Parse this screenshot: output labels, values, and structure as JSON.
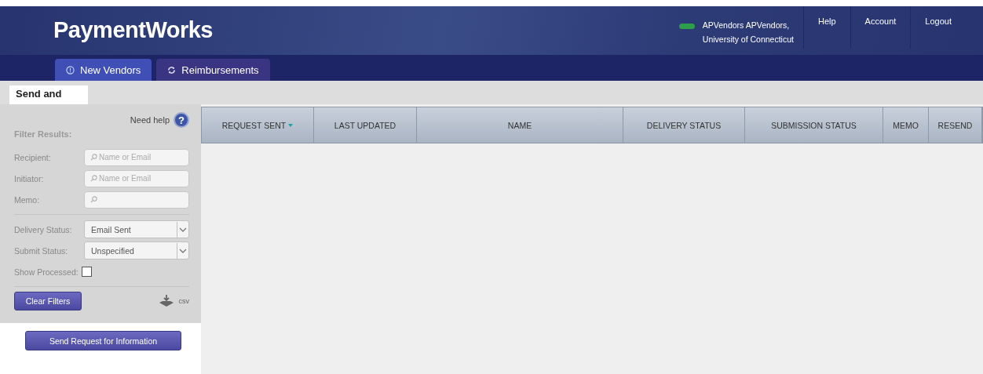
{
  "header": {
    "logo": "PaymentWorks",
    "user_line_1": "APVendors APVendors,",
    "user_line_2": "University of Connecticut",
    "links": [
      "Help",
      "Account",
      "Logout"
    ]
  },
  "tabs": [
    {
      "label": "New Vendors",
      "kind": "info",
      "selected": true
    },
    {
      "label": "Reimbursements",
      "kind": "sync",
      "selected": false
    }
  ],
  "page_tab": {
    "label": "Send and"
  },
  "sidebar": {
    "help_label": "Need help",
    "help_icon": "?",
    "filter_title": "Filter Results:",
    "text_filters": [
      {
        "label": "Recipient:",
        "placeholder": "Name or Email"
      },
      {
        "label": "Initiator:",
        "placeholder": "Name or Email"
      },
      {
        "label": "Memo:"
      }
    ],
    "select_filters": [
      {
        "label": "Delivery Status:",
        "value": "Email Sent"
      },
      {
        "label": "Submit Status:",
        "value": "Unspecified"
      }
    ],
    "show_processed": {
      "label": "Show Processed:",
      "checked": false
    },
    "clear_button": "Clear Filters",
    "csv_label": "csv"
  },
  "send_button": "Send Request for Information",
  "table": {
    "columns": [
      {
        "label": "REQUEST SENT",
        "sorted": true
      },
      {
        "label": "LAST UPDATED",
        "sorted": false
      },
      {
        "label": "NAME",
        "sorted": false
      },
      {
        "label": "DELIVERY STATUS",
        "sorted": false
      },
      {
        "label": "SUBMISSION STATUS",
        "sorted": false
      },
      {
        "label": "MEMO",
        "sorted": false
      },
      {
        "label": "RESEND",
        "sorted": false
      }
    ]
  }
}
